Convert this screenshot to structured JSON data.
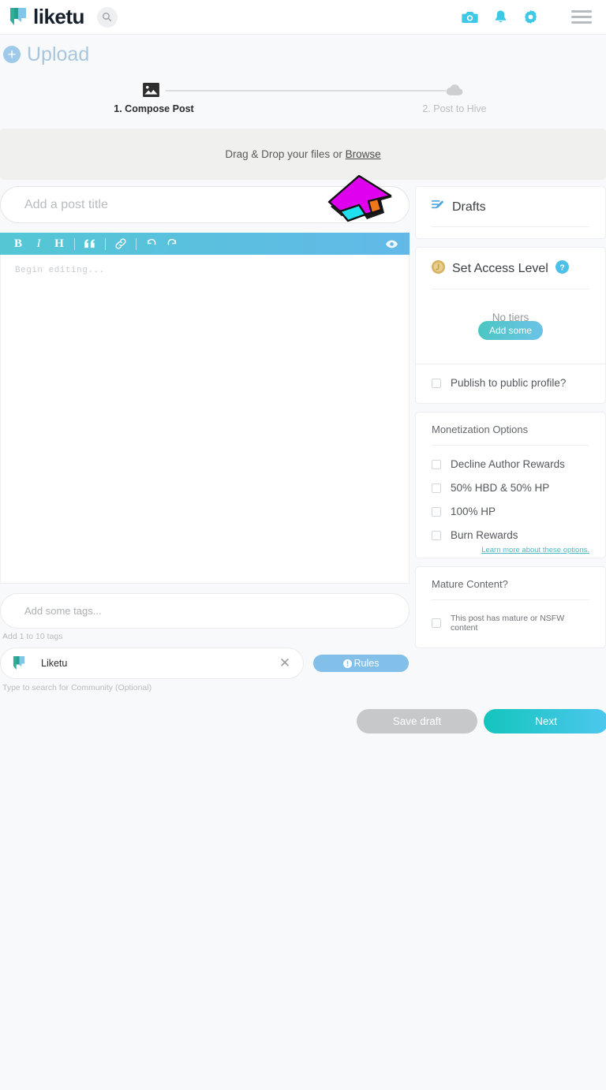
{
  "header": {
    "logo_text": "liketu",
    "logo_icon": "liketu-logo-icon",
    "search_icon": "search-icon",
    "camera_icon": "camera-icon",
    "bell_icon": "bell-icon",
    "gear_icon": "gear-icon",
    "menu_icon": "hamburger-menu-icon"
  },
  "upload": {
    "label": "Upload",
    "plus_icon": "plus-circle-icon",
    "plus_glyph": "+"
  },
  "stepper": {
    "steps": [
      {
        "label": "1. Compose Post",
        "icon": "image-icon",
        "active": true
      },
      {
        "label": "2. Post to Hive",
        "icon": "cloud-upload-icon",
        "active": false
      }
    ]
  },
  "dropzone": {
    "text_before": "Drag & Drop your files or ",
    "browse_label": "Browse"
  },
  "composer": {
    "title_placeholder": "Add a post title",
    "title_value": "",
    "editor_placeholder": "Begin editing...",
    "toolbar": [
      {
        "name": "bold-button",
        "glyph": "B"
      },
      {
        "name": "italic-button",
        "glyph": "I"
      },
      {
        "name": "heading-button",
        "glyph": "H"
      },
      {
        "name": "quote-button",
        "glyph": "“"
      },
      {
        "name": "link-button",
        "glyph": "ὑ7"
      },
      {
        "name": "undo-button",
        "glyph": "↶"
      },
      {
        "name": "redo-button",
        "glyph": "↷"
      }
    ],
    "preview_icon": "eye-preview-icon"
  },
  "tags": {
    "placeholder": "Add some tags...",
    "value": "",
    "hint": "Add 1 to 10 tags"
  },
  "community": {
    "name": "Liketu",
    "clear_glyph": "✕",
    "rules_label": "Rules",
    "rules_icon": "info-icon",
    "hint": "Type to search for Community (Optional)"
  },
  "sidebar": {
    "drafts": {
      "title": "Drafts",
      "icon": "drafts-edit-icon"
    },
    "access_level": {
      "title": "Set Access Level",
      "icon": "coin-icon",
      "help_icon": "help-question-icon",
      "help_glyph": "?",
      "no_tiers_label": "No tiers",
      "add_some_label": "Add some",
      "publish_public_label": "Publish to public profile?",
      "publish_public_checked": false
    },
    "monetization": {
      "title": "Monetization Options",
      "options": [
        {
          "label": "Decline Author Rewards",
          "checked": false
        },
        {
          "label": "50% HBD & 50% HP",
          "checked": false
        },
        {
          "label": "100% HP",
          "checked": false
        },
        {
          "label": "Burn Rewards",
          "checked": false
        }
      ],
      "learn_more_label": "Learn more about these options."
    },
    "mature": {
      "title": "Mature Content?",
      "checkbox_label": "This post has mature or NSFW content",
      "checked": false
    }
  },
  "actions": {
    "save_draft_label": "Save draft",
    "next_label": "Next"
  },
  "colors": {
    "accent_cyan": "#4ec7ef",
    "accent_teal": "#13c5bd",
    "logo_dark": "#16202c",
    "upload_blue": "#a8c6de",
    "rules_blue": "#82c0ea",
    "toolbar_gradient_start": "#53c7d4",
    "toolbar_gradient_end": "#62b9e8",
    "disabled_gray": "#c7c8c9",
    "arrow_magenta": "#e000f0",
    "arrow_cyan": "#20e0f0",
    "arrow_orange": "#f07818"
  }
}
